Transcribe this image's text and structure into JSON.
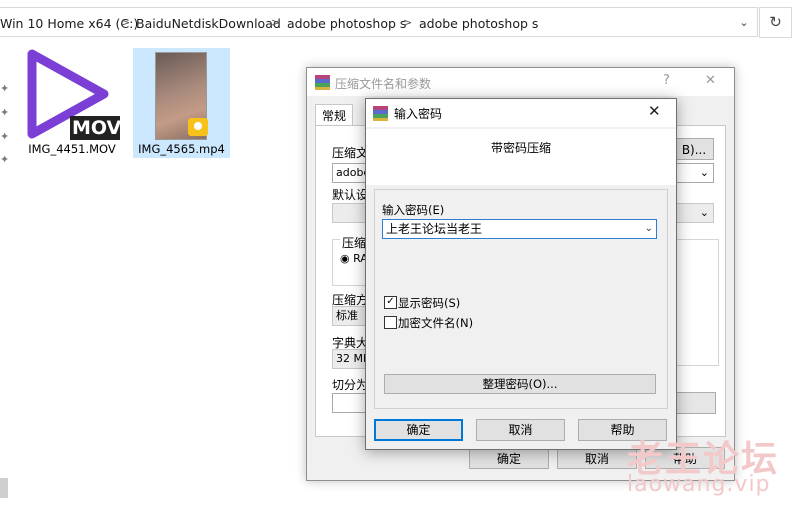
{
  "address_bar": {
    "crumbs": [
      "Win 10 Home x64 (C:)",
      "BaiduNetdiskDownload",
      "adobe photoshop s",
      "adobe photoshop s"
    ],
    "separator": ">",
    "dropdown_glyph": "⌄",
    "refresh_glyph": "↻"
  },
  "files": [
    {
      "name": "IMG_4451.MOV",
      "badge": "MOV",
      "icon": "video-player-icon",
      "selected": false
    },
    {
      "name": "IMG_4565.mp4",
      "icon": "video-thumbnail",
      "selected": true
    }
  ],
  "archive_dialog": {
    "title": "压缩文件名和参数",
    "help_glyph": "?",
    "close_glyph": "✕",
    "tabs": [
      "常规"
    ],
    "labels": {
      "archive_name": "压缩文",
      "default_settings": "默认设",
      "format_group": "压缩",
      "format_radio": "RA",
      "method": "压缩方",
      "dictionary": "字典大",
      "split": "切分为"
    },
    "values": {
      "archive_name": "adobe",
      "method": "标准",
      "dictionary": "32 MB"
    },
    "browse_button": "B)...",
    "ok_button": "确定",
    "cancel_button": "取消",
    "help_button": "帮助"
  },
  "password_dialog": {
    "title": "输入密码",
    "close_glyph": "✕",
    "header": "带密码压缩",
    "input_label": "输入密码(E)",
    "password_value": "上老王论坛当老王",
    "show_password_label": "显示密码(S)",
    "show_password_checked": true,
    "encrypt_names_label": "加密文件名(N)",
    "encrypt_names_checked": false,
    "organize_button": "整理密码(O)...",
    "ok_button": "确定",
    "cancel_button": "取消",
    "help_button": "帮助"
  },
  "watermark": {
    "line1": "老王论坛",
    "line2": "laowang.vip"
  },
  "colors": {
    "selection": "#cce8ff",
    "focus_blue": "#0078d7",
    "mov_icon_purple": "#7b3fd6"
  }
}
